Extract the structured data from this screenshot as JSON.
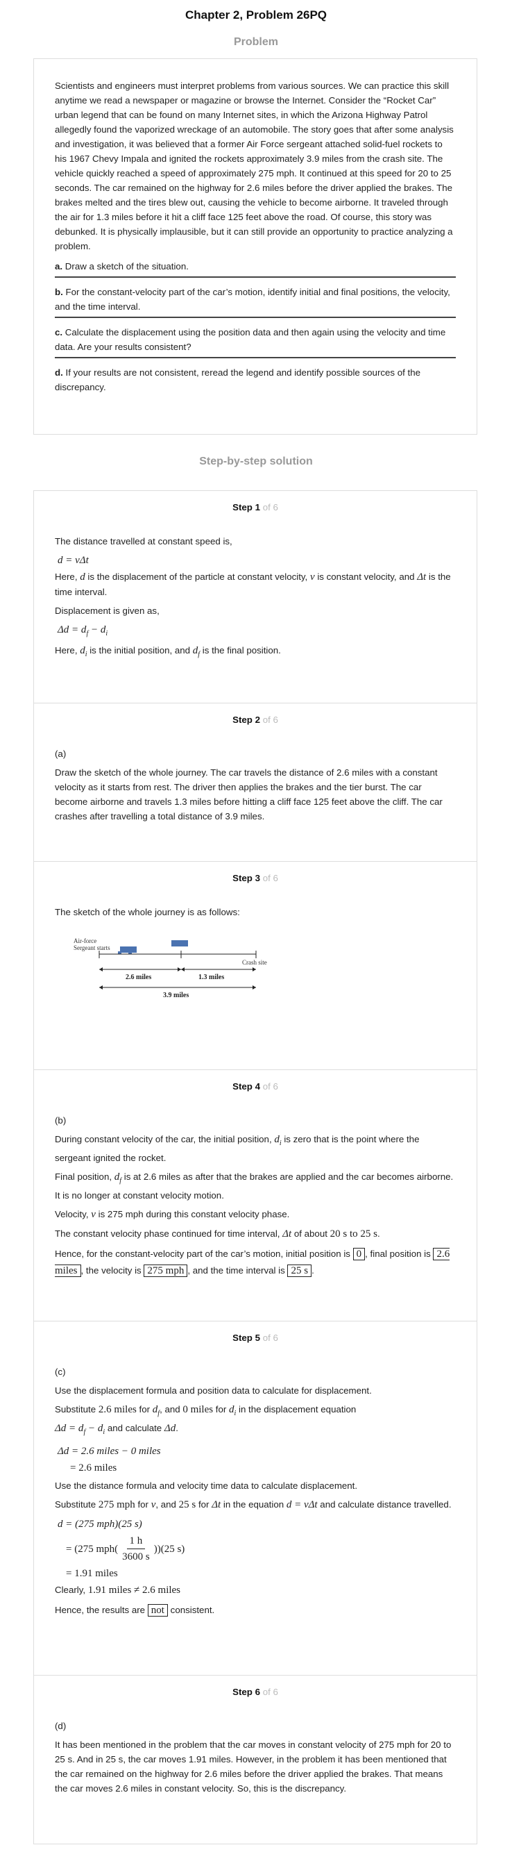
{
  "page_title": "Chapter 2, Problem 26PQ",
  "problem_heading": "Problem",
  "problem": {
    "intro": "Scientists and engineers must interpret problems from various sources. We can practice this skill anytime we read a newspaper or magazine or browse the Internet. Consider the “Rocket Car” urban legend that can be found on many Internet sites, in which the Arizona Highway Patrol allegedly found the vaporized wreckage of an automobile. The story goes that after some analysis and investigation, it was believed that a former Air Force sergeant attached solid-fuel rockets to his 1967 Chevy Impala and ignited the rockets approximately 3.9 miles from the crash site. The vehicle quickly reached a speed of approximately 275 mph. It continued at this speed for 20 to 25 seconds. The car remained on the highway for 2.6 miles before the driver applied the brakes. The brakes melted and the tires blew out, causing the vehicle to become airborne. It traveled through the air for 1.3 miles before it hit a cliff face 125 feet above the road. Of course, this story was debunked. It is physically implausible, but it can still provide an opportunity to practice analyzing a problem.",
    "parts": [
      {
        "label": "a.",
        "text": "Draw a sketch of the situation."
      },
      {
        "label": "b.",
        "text": "For the constant-velocity part of the car’s motion, identify initial and final positions, the velocity, and the time interval."
      },
      {
        "label": "c.",
        "text": "Calculate the displacement using the position data and then again using the velocity and time data. Are your results consistent?"
      },
      {
        "label": "d.",
        "text": "If your results are not consistent, reread the legend and identify possible sources of the discrepancy."
      }
    ]
  },
  "solution_heading": "Step-by-step solution",
  "steps": [
    {
      "word": "Step",
      "num": "1",
      "of": "of 6"
    },
    {
      "word": "Step",
      "num": "2",
      "of": "of 6"
    },
    {
      "word": "Step",
      "num": "3",
      "of": "of 6"
    },
    {
      "word": "Step",
      "num": "4",
      "of": "of 6"
    },
    {
      "word": "Step",
      "num": "5",
      "of": "of 6"
    },
    {
      "word": "Step",
      "num": "6",
      "of": "of 6"
    }
  ],
  "step1": {
    "l1": "The distance travelled at constant speed is,",
    "eq1": "d = vΔt",
    "here1": "Here,",
    "d": "d",
    "t1": "is the displacement of the particle at constant velocity,",
    "v": "v",
    "t2": "is constant velocity, and",
    "dt": "Δt",
    "t3": "is the time interval.",
    "l2": "Displacement is given as,",
    "eq2": "Δd = d",
    "eq2b": " − d",
    "here2": "Here,",
    "t4": "is the initial position, and",
    "t5": "is the final position."
  },
  "step2": {
    "label": "(a)",
    "text": "Draw the sketch of the whole journey. The car travels the distance of 2.6 miles with a constant velocity as it starts from rest. The driver then applies the brakes and the tier burst. The car become airborne and travels 1.3 miles before hitting a cliff face 125 feet above the cliff. The car crashes after travelling a total distance of 3.9 miles."
  },
  "step3": {
    "text": "The sketch of the whole journey is as follows:",
    "sketch": {
      "start_label_1": "Air-force",
      "start_label_2": "Sergeant starts",
      "crash": "Crash site",
      "seg1": "2.6 miles",
      "seg2": "1.3 miles",
      "total": "3.9 miles"
    }
  },
  "step4": {
    "label": "(b)",
    "p1a": "During constant velocity of the car, the initial position,",
    "p1b": "is zero that is the point where the sergeant ignited the rocket.",
    "p2a": "Final position,",
    "p2b": "is at 2.6 miles as after that the brakes are applied and the car becomes airborne. It is no longer at constant velocity motion.",
    "p3a": "Velocity,",
    "p3b": "is 275 mph during this constant velocity phase.",
    "p4a": "The constant velocity phase continued for time interval,",
    "p4b": "of about",
    "p4c": "20 s to 25 s",
    "p5a": "Hence, for the constant-velocity part of the car’s motion, initial position is",
    "box0": "0",
    "p5b": ", final position is",
    "box1": "2.6 miles",
    "p5c": ", the velocity is",
    "box2": "275 mph",
    "p5d": ", and the time interval is",
    "box3": "25 s"
  },
  "step5": {
    "label": "(c)",
    "l1": "Use the displacement formula and position data to calculate for displacement.",
    "s1": "Substitute",
    "v1": "2.6 miles",
    "for": "for",
    "and": ", and",
    "v2": "0 miles",
    "s2": "in the displacement equation",
    "s3": "and calculate",
    "e1": "Δd = 2.6 miles − 0 miles",
    "e2": "= 2.6 miles",
    "l2": "Use the distance formula and velocity time data to calculate displacement.",
    "s4": "Substitute",
    "v3": "275 mph",
    "v4": "25 s",
    "s5": "in the equation",
    "s6": "and calculate distance travelled.",
    "e3": "d = (275 mph)(25 s)",
    "e4a": "= (275 mph(",
    "e4n": "1 h",
    "e4d": "3600 s",
    "e4b": "))(25 s)",
    "e5": "= 1.91 miles",
    "c1": "Clearly,",
    "c2": "1.91 miles ≠ 2.6 miles",
    "h1": "Hence, the results are",
    "hbox": "not",
    "h2": "consistent."
  },
  "step6": {
    "label": "(d)",
    "text": "It has been mentioned in the problem that the car moves in constant velocity of 275 mph for 20 to 25 s. And in 25 s, the car moves 1.91 miles. However, in the problem it has been mentioned that the car remained on the highway for 2.6 miles before the driver applied the brakes. That means the car moves 2.6 miles in constant velocity. So, this is the discrepancy."
  },
  "colors": {
    "accent": "#4a72b0",
    "muted": "#999999",
    "border": "#dddddd"
  }
}
